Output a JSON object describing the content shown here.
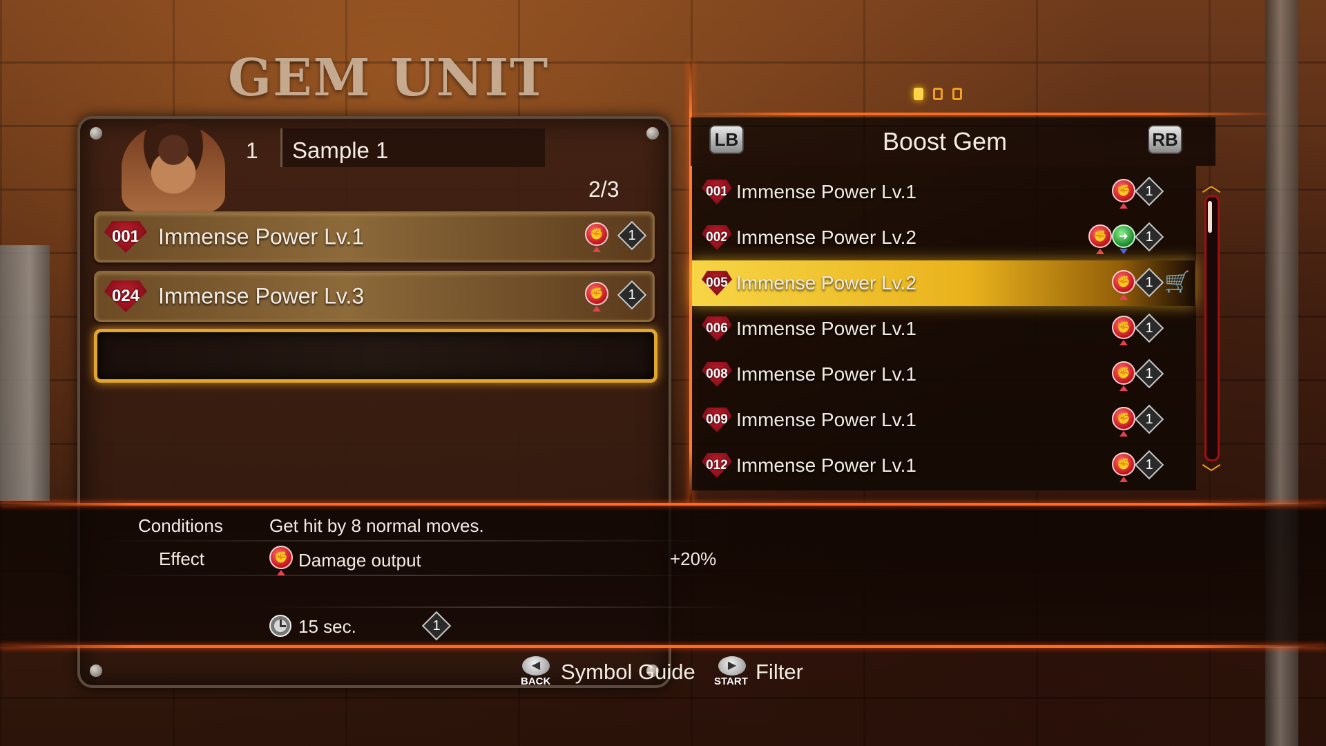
{
  "screen": {
    "title": "GEM UNIT",
    "page_indicator": {
      "count": 3,
      "active": 1
    }
  },
  "unit": {
    "number": "1",
    "name": "Sample 1",
    "slot_count": "2/3",
    "slots": [
      {
        "id": "001",
        "name": "Immense Power Lv.1",
        "cost": "1"
      },
      {
        "id": "024",
        "name": "Immense Power Lv.3",
        "cost": "1"
      },
      {
        "empty": true
      }
    ]
  },
  "gem_list": {
    "prev_button": "LB",
    "next_button": "RB",
    "category": "Boost Gem",
    "items": [
      {
        "id": "001",
        "name": "Immense Power Lv.1",
        "cost": "1",
        "icons": [
          "power-icon"
        ]
      },
      {
        "id": "002",
        "name": "Immense Power Lv.2",
        "cost": "1",
        "icons": [
          "power-icon",
          "speed-icon"
        ]
      },
      {
        "id": "005",
        "name": "Immense Power Lv.2",
        "cost": "1",
        "icons": [
          "power-icon"
        ],
        "selected": true,
        "cart": true
      },
      {
        "id": "006",
        "name": "Immense Power Lv.1",
        "cost": "1",
        "icons": [
          "power-icon"
        ]
      },
      {
        "id": "008",
        "name": "Immense Power Lv.1",
        "cost": "1",
        "icons": [
          "power-icon"
        ]
      },
      {
        "id": "009",
        "name": "Immense Power Lv.1",
        "cost": "1",
        "icons": [
          "power-icon"
        ]
      },
      {
        "id": "012",
        "name": "Immense Power Lv.1",
        "cost": "1",
        "icons": [
          "power-icon"
        ]
      }
    ]
  },
  "details": {
    "conditions_label": "Conditions",
    "conditions_value": "Get hit by 8 normal moves.",
    "effect_label": "Effect",
    "effect_value": "Damage output",
    "effect_amount": "+20%",
    "duration": "15 sec.",
    "cost": "1"
  },
  "footer": {
    "back_label": "BACK",
    "symbol_guide": "Symbol Guide",
    "start_label": "START",
    "filter": "Filter"
  },
  "colors": {
    "accent_orange": "#ff6a20",
    "selected_row": "#f7d545",
    "gem_red": "#c82030"
  }
}
